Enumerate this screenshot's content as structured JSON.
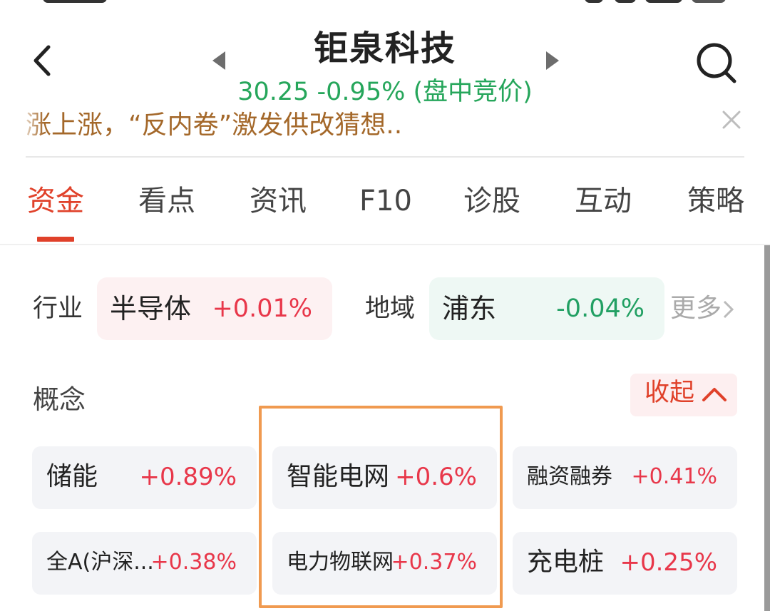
{
  "header": {
    "back_icon": "chevron-left-icon",
    "title": "钜泉科技",
    "quote": "30.25 -0.95% (盘中竞价)",
    "search_icon": "search-icon",
    "quote_color": "#26a65b"
  },
  "ticker": {
    "text": "涨上涨，“反内卷”激发供改猜想..",
    "close_icon": "close-icon"
  },
  "tabs": [
    {
      "label": "资金",
      "active": true
    },
    {
      "label": "看点"
    },
    {
      "label": "资讯"
    },
    {
      "label": "F10"
    },
    {
      "label": "诊股"
    },
    {
      "label": "互动"
    },
    {
      "label": "策略"
    }
  ],
  "industry": {
    "label": "行业",
    "name": "半导体",
    "change": "+0.01%"
  },
  "region": {
    "label": "地域",
    "name": "浦东",
    "change": "-0.04%"
  },
  "more": {
    "label": "更多",
    "icon": "chevron-right-icon"
  },
  "concept": {
    "label": "概念",
    "collapse_label": "收起",
    "collapse_icon": "chevron-up-icon",
    "items": [
      {
        "name": "储能",
        "change": "+0.89%"
      },
      {
        "name": "智能电网",
        "change": "+0.6%"
      },
      {
        "name": "融资融券",
        "change": "+0.41%"
      },
      {
        "name": "全A(沪深...",
        "change": "+0.38%"
      },
      {
        "name": "电力物联网",
        "change": "+0.37%"
      },
      {
        "name": "充电桩",
        "change": "+0.25%"
      }
    ]
  },
  "colors": {
    "accent": "#e0412a",
    "up": "#e8374a",
    "down": "#22a063",
    "highlight": "#f09a50"
  }
}
